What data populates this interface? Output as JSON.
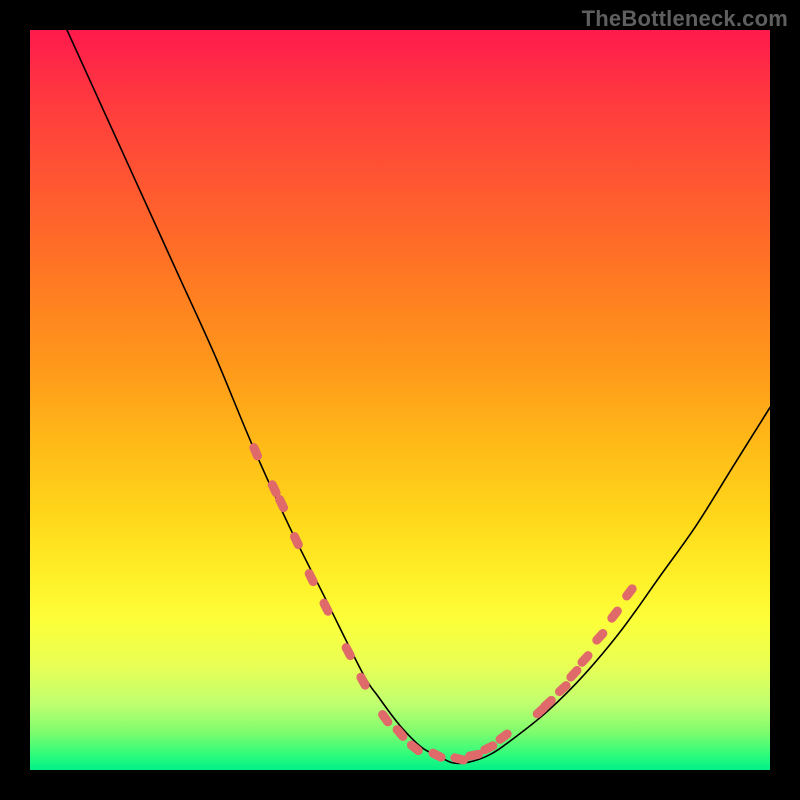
{
  "watermark": "TheBottleneck.com",
  "colors": {
    "background": "#000000",
    "curve": "#000000",
    "markers": "#e06a6a",
    "gradient_top": "#ff1a4d",
    "gradient_bottom": "#00f088"
  },
  "chart_data": {
    "type": "line",
    "title": "",
    "xlabel": "",
    "ylabel": "",
    "xlim": [
      0,
      100
    ],
    "ylim": [
      0,
      100
    ],
    "grid": false,
    "legend": false,
    "series": [
      {
        "name": "bottleneck-curve",
        "x": [
          5,
          10,
          15,
          20,
          25,
          30,
          35,
          40,
          45,
          47,
          50,
          53,
          55,
          57,
          59,
          62,
          65,
          70,
          75,
          80,
          85,
          90,
          95,
          100
        ],
        "y": [
          100,
          89,
          78,
          67,
          56,
          44,
          33,
          23,
          13,
          10,
          6,
          3,
          2,
          1,
          1,
          2,
          4,
          8,
          13,
          19,
          26,
          33,
          41,
          49
        ]
      }
    ],
    "markers": {
      "name": "highlight-dots",
      "points": [
        {
          "x": 30.5,
          "y": 43
        },
        {
          "x": 33,
          "y": 38
        },
        {
          "x": 34,
          "y": 36
        },
        {
          "x": 36,
          "y": 31
        },
        {
          "x": 38,
          "y": 26
        },
        {
          "x": 40,
          "y": 22
        },
        {
          "x": 43,
          "y": 16
        },
        {
          "x": 45,
          "y": 12
        },
        {
          "x": 48,
          "y": 7
        },
        {
          "x": 50,
          "y": 5
        },
        {
          "x": 52,
          "y": 3
        },
        {
          "x": 55,
          "y": 2
        },
        {
          "x": 58,
          "y": 1.5
        },
        {
          "x": 60,
          "y": 2
        },
        {
          "x": 62,
          "y": 3
        },
        {
          "x": 64,
          "y": 4.5
        },
        {
          "x": 69,
          "y": 8
        },
        {
          "x": 70,
          "y": 9
        },
        {
          "x": 72,
          "y": 11
        },
        {
          "x": 73.5,
          "y": 13
        },
        {
          "x": 75,
          "y": 15
        },
        {
          "x": 77,
          "y": 18
        },
        {
          "x": 79,
          "y": 21
        },
        {
          "x": 81,
          "y": 24
        }
      ]
    }
  }
}
